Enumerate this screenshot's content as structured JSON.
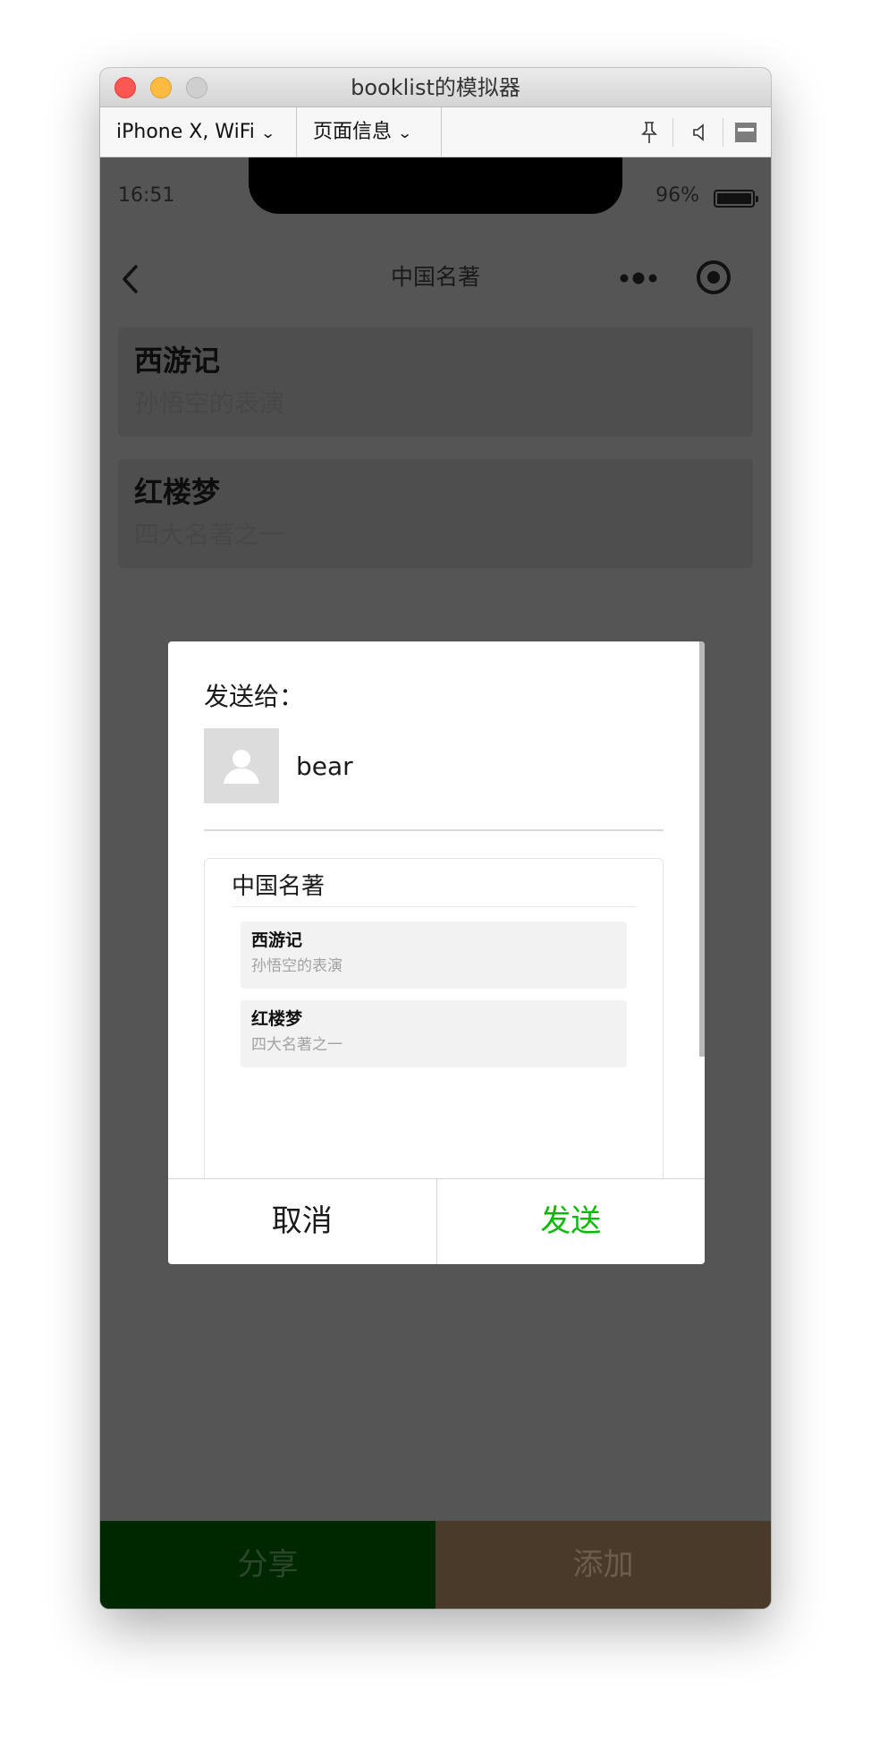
{
  "window": {
    "title": "booklist的模拟器"
  },
  "toolbar": {
    "device_select": "iPhone X, WiFi",
    "page_info_select": "页面信息"
  },
  "status_bar": {
    "time": "16:51",
    "battery_percent": "96%"
  },
  "nav": {
    "title": "中国名著"
  },
  "books": [
    {
      "title": "西游记",
      "description": "孙悟空的表演"
    },
    {
      "title": "红楼梦",
      "description": "四大名著之一"
    }
  ],
  "bottom_bar": {
    "share_label": "分享",
    "add_label": "添加"
  },
  "dialog": {
    "send_to_label": "发送给：",
    "recipient": "bear",
    "preview_title": "中国名著",
    "cancel_label": "取消",
    "send_label": "发送"
  },
  "colors": {
    "send_green": "#09bb07",
    "share_bg": "#002800",
    "add_bg": "#493a29",
    "overlay": "#555555"
  }
}
